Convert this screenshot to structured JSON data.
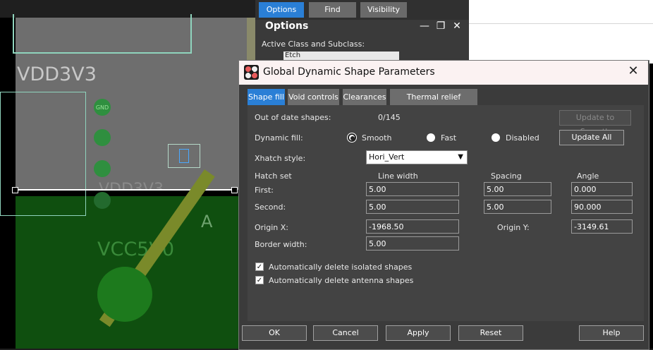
{
  "canvas": {
    "nets": {
      "vdd_top": "VDD3V3",
      "vdd_partial": "VDD3V3",
      "vcc": "VCC5V0",
      "gnd_pad": "GND",
      "silk_a": "A"
    }
  },
  "options_panel": {
    "tabs": [
      "Options",
      "Find",
      "Visibility"
    ],
    "title": "Options",
    "active_class_label": "Active Class and Subclass:",
    "class_value": "Etch"
  },
  "dialog": {
    "title": "Global Dynamic Shape Parameters",
    "tabs": [
      "Shape fill",
      "Void controls",
      "Clearances",
      "Thermal relief connects"
    ],
    "out_of_date_label": "Out of date shapes:",
    "out_of_date_value": "0/145",
    "update_smooth": "Update to Smooth",
    "dynamic_fill_label": "Dynamic fill:",
    "fill_options": [
      "Smooth",
      "Fast",
      "Disabled"
    ],
    "update_all": "Update All",
    "xhatch_label": "Xhatch style:",
    "xhatch_value": "Hori_Vert",
    "hatch_set_label": "Hatch set",
    "col_line_width": "Line width",
    "col_spacing": "Spacing",
    "col_angle": "Angle",
    "first_label": "First:",
    "second_label": "Second:",
    "first": {
      "line_width": "5.00",
      "spacing": "5.00",
      "angle": "0.000"
    },
    "second": {
      "line_width": "5.00",
      "spacing": "5.00",
      "angle": "90.000"
    },
    "origin_x_label": "Origin X:",
    "origin_x": "-1968.50",
    "origin_y_label": "Origin Y:",
    "origin_y": "-3149.61",
    "border_label": "Border width:",
    "border_width": "5.00",
    "check_isolated": "Automatically delete isolated shapes",
    "check_antenna": "Automatically delete antenna shapes",
    "buttons": {
      "ok": "OK",
      "cancel": "Cancel",
      "apply": "Apply",
      "reset": "Reset",
      "help": "Help"
    }
  }
}
